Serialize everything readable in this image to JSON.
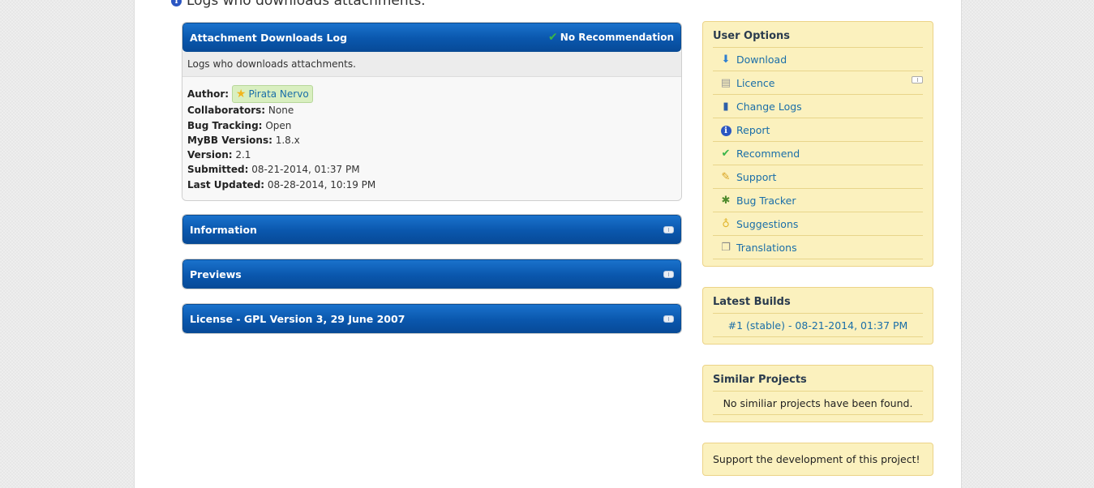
{
  "page_heading": "Logs who downloads attachments.",
  "project": {
    "title": "Attachment Downloads Log",
    "recommendation": "No Recommendation",
    "description": "Logs who downloads attachments.",
    "details": [
      {
        "label": "Author:",
        "value": "Pirata Nervo"
      },
      {
        "label": "Collaborators:",
        "value": "None"
      },
      {
        "label": "Bug Tracking:",
        "value": "Open"
      },
      {
        "label": "MyBB Versions:",
        "value": "1.8.x"
      },
      {
        "label": "Version:",
        "value": "2.1"
      },
      {
        "label": "Submitted:",
        "value": "08-21-2014, 01:37 PM"
      },
      {
        "label": "Last Updated:",
        "value": "08-28-2014, 10:19 PM"
      }
    ]
  },
  "sections": [
    {
      "title": "Information"
    },
    {
      "title": "Previews"
    },
    {
      "title": "License - GPL Version 3, 29 June 2007"
    }
  ],
  "user_options": {
    "title": "User Options",
    "items": [
      {
        "label": "Download",
        "icon": "download-arrow-icon"
      },
      {
        "label": "Licence",
        "icon": "document-icon"
      },
      {
        "label": "Change Logs",
        "icon": "book-icon"
      },
      {
        "label": "Report",
        "icon": "info-icon"
      },
      {
        "label": "Recommend",
        "icon": "check-icon"
      },
      {
        "label": "Support",
        "icon": "pencil-icon"
      },
      {
        "label": "Bug Tracker",
        "icon": "bug-icon"
      },
      {
        "label": "Suggestions",
        "icon": "lightbulb-icon"
      },
      {
        "label": "Translations",
        "icon": "pages-icon"
      }
    ]
  },
  "latest_builds": {
    "title": "Latest Builds",
    "build": "#1 (stable) - 08-21-2014, 01:37 PM"
  },
  "similar_projects": {
    "title": "Similar Projects",
    "message": "No similiar projects have been found."
  },
  "support_dev": {
    "text": "Support the development of this project!"
  },
  "colors": {
    "header_blue": "#0a57ad",
    "sidebar_bg": "#fbf1be",
    "link": "#1a6ea8"
  }
}
